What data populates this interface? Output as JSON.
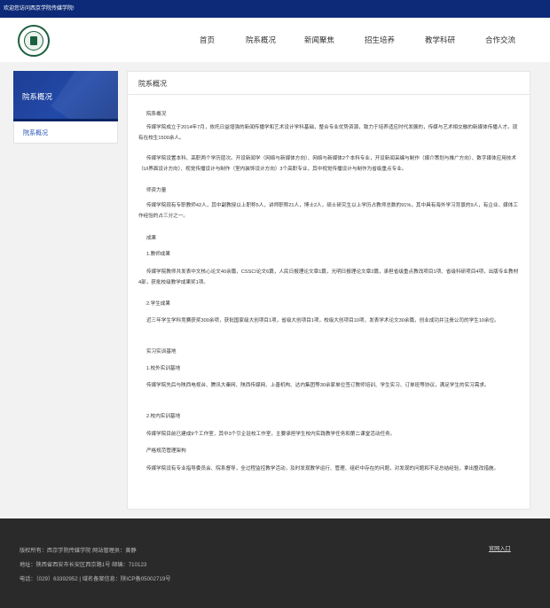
{
  "topbar": {
    "welcome": "欢迎您访问西京学院传媒学院!"
  },
  "nav": {
    "items": [
      "首页",
      "院系概况",
      "新闻聚焦",
      "招生培养",
      "教学科研",
      "合作交流"
    ]
  },
  "sidebar": {
    "title": "院系概况",
    "items": [
      "院系概况"
    ]
  },
  "main": {
    "title": "院系概况",
    "paragraphs": [
      "院系概况",
      "传媒学院成立于2014年7月，依托日益增强的新闻传播学和艺术设计学科基础，整合专业优势资源，致力于培养适应时代发展的，传媒与艺术相交融的新媒体传播人才。现有在校生1500余人。",
      "传媒学院设置本科、高职两个学历层次。开设新闻学（网络与新媒体方向）、网络与新媒体2个本科专业，开设新闻采编与制作（媒介策划与推广方向）、数字媒体应用技术（UI界面设计方向）、视觉传播设计与制作（室内装饰设计方向）3个高职专业，其中视觉传播设计与制作为省级重点专业。",
      "师资力量",
      "传媒学院现有专职教师42人，其中副教授以上职称5人，讲师职称21人，博士2人，硕士研究生以上学历占教师总数的91%，其中具有海外学习背景的9人，有企业、媒体工作经验的占三分之一。",
      "成果",
      "1.教师成果",
      "传媒学院教师共发表中文核心论文40余篇，CSSCI论文6篇，人民日报理论文章1篇，光明日报理论文章2篇，承担省级重点教改项目1项、省级科研项目4项，出版专业教材4部，获批校级教学成果奖1项。",
      "2.学生成果",
      "近三年学生学科竞赛获奖300余项，获批国家级大创项目1项，省级大创项目1项，校级大创项目10项，发表学术论文30余篇，创业成功并注册公司的学生10余位。",
      "实习实训基地",
      "1.校外实训基地",
      "传媒学院先后与陕西电视台、腾讯大秦网、陕西传媒网、上善机构、达内集团等30余家单位签订教师培训、学生实习、订单班等协议，满足学生的实习需求。",
      "2.校内实训基地",
      "传媒学院目前已建成9个工作室，其中3个引企驻校工作室，主要承担学生校内实践教学任务和第二课堂活动任务。",
      "严格规范管理架构",
      "传媒学院设有专业指导委员会、院系督导，全过程监控教学活动，及时发现教学运行、管理、组织中存在的问题，对发现的问题和不足总结经验，拿出整改措施。"
    ]
  },
  "footer": {
    "copyright": "版权所有：西京学院传媒学院  网站管理员：黄静",
    "address": "地址：陕西省西安市长安区西京路1号 邮编：710123",
    "phone": "电话：（029）63392952 | 域名备案信息：陕ICP备05002719号",
    "admin_link": "官网入口"
  }
}
